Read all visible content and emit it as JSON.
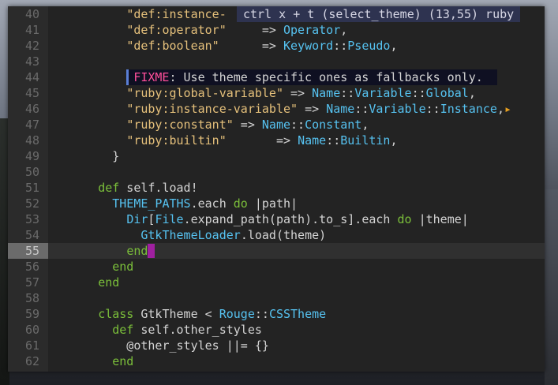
{
  "popup": {
    "text": "ctrl x + t (select_theme) (13,55) ruby"
  },
  "lines": [
    {
      "n": "40",
      "parts": [
        [
          "t",
          "          "
        ],
        [
          "s",
          "\"def:instance-"
        ]
      ]
    },
    {
      "n": "41",
      "parts": [
        [
          "t",
          "          "
        ],
        [
          "s",
          "\"def:operator\""
        ],
        [
          "t",
          "     => "
        ],
        [
          "c",
          "Operator"
        ],
        [
          "t",
          ","
        ]
      ]
    },
    {
      "n": "42",
      "parts": [
        [
          "t",
          "          "
        ],
        [
          "s",
          "\"def:boolean\""
        ],
        [
          "t",
          "      => "
        ],
        [
          "c",
          "Keyword"
        ],
        [
          "t",
          "::"
        ],
        [
          "c",
          "Pseudo"
        ],
        [
          "t",
          ","
        ]
      ]
    },
    {
      "n": "43",
      "parts": []
    },
    {
      "n": "44",
      "fixme": true,
      "label": "FIXME",
      "text": ": Use theme specific ones as fallbacks only."
    },
    {
      "n": "45",
      "parts": [
        [
          "t",
          "          "
        ],
        [
          "s",
          "\"ruby:global-variable\""
        ],
        [
          "t",
          " => "
        ],
        [
          "c",
          "Name"
        ],
        [
          "t",
          "::"
        ],
        [
          "c",
          "Variable"
        ],
        [
          "t",
          "::"
        ],
        [
          "c",
          "Global"
        ],
        [
          "t",
          ","
        ]
      ]
    },
    {
      "n": "46",
      "parts": [
        [
          "t",
          "          "
        ],
        [
          "s",
          "\"ruby:instance-variable\""
        ],
        [
          "t",
          " => "
        ],
        [
          "c",
          "Name"
        ],
        [
          "t",
          "::"
        ],
        [
          "c",
          "Variable"
        ],
        [
          "t",
          "::"
        ],
        [
          "c",
          "Instance"
        ],
        [
          "t",
          ","
        ]
      ],
      "overflow": "▸"
    },
    {
      "n": "47",
      "parts": [
        [
          "t",
          "          "
        ],
        [
          "s",
          "\"ruby:constant\""
        ],
        [
          "t",
          " => "
        ],
        [
          "c",
          "Name"
        ],
        [
          "t",
          "::"
        ],
        [
          "c",
          "Constant"
        ],
        [
          "t",
          ","
        ]
      ]
    },
    {
      "n": "48",
      "parts": [
        [
          "t",
          "          "
        ],
        [
          "s",
          "\"ruby:builtin\""
        ],
        [
          "t",
          "       => "
        ],
        [
          "c",
          "Name"
        ],
        [
          "t",
          "::"
        ],
        [
          "c",
          "Builtin"
        ],
        [
          "t",
          ","
        ]
      ]
    },
    {
      "n": "49",
      "parts": [
        [
          "t",
          "        }"
        ]
      ]
    },
    {
      "n": "50",
      "parts": []
    },
    {
      "n": "51",
      "parts": [
        [
          "t",
          "      "
        ],
        [
          "k",
          "def"
        ],
        [
          "t",
          " self.load!"
        ]
      ]
    },
    {
      "n": "52",
      "parts": [
        [
          "t",
          "        "
        ],
        [
          "c",
          "THEME_PATHS"
        ],
        [
          "t",
          ".each "
        ],
        [
          "k",
          "do"
        ],
        [
          "t",
          " |path|"
        ]
      ]
    },
    {
      "n": "53",
      "parts": [
        [
          "t",
          "          "
        ],
        [
          "c",
          "Dir"
        ],
        [
          "t",
          "["
        ],
        [
          "c",
          "File"
        ],
        [
          "t",
          ".expand_path(path).to_s].each "
        ],
        [
          "k",
          "do"
        ],
        [
          "t",
          " |theme|"
        ]
      ]
    },
    {
      "n": "54",
      "parts": [
        [
          "t",
          "            "
        ],
        [
          "c",
          "GtkThemeLoader"
        ],
        [
          "t",
          ".load(theme)"
        ]
      ]
    },
    {
      "n": "55",
      "current": true,
      "parts": [
        [
          "t",
          "          "
        ],
        [
          "k",
          "end"
        ]
      ]
    },
    {
      "n": "56",
      "parts": [
        [
          "t",
          "        "
        ],
        [
          "k",
          "end"
        ]
      ]
    },
    {
      "n": "57",
      "parts": [
        [
          "t",
          "      "
        ],
        [
          "k",
          "end"
        ]
      ]
    },
    {
      "n": "58",
      "parts": []
    },
    {
      "n": "59",
      "parts": [
        [
          "t",
          "      "
        ],
        [
          "k",
          "class"
        ],
        [
          "t",
          " GtkTheme < "
        ],
        [
          "c",
          "Rouge"
        ],
        [
          "t",
          "::"
        ],
        [
          "c",
          "CSSTheme"
        ]
      ]
    },
    {
      "n": "60",
      "parts": [
        [
          "t",
          "        "
        ],
        [
          "k",
          "def"
        ],
        [
          "t",
          " self.other_styles"
        ]
      ]
    },
    {
      "n": "61",
      "parts": [
        [
          "t",
          "          @other_styles ||= {}"
        ]
      ]
    },
    {
      "n": "62",
      "parts": [
        [
          "t",
          "        "
        ],
        [
          "k",
          "end"
        ]
      ]
    }
  ],
  "colors": {
    "string": "#e5c07b",
    "keyword": "#7bbf3a",
    "constant": "#56c2f0",
    "cursor": "#a020a0",
    "fixme": "#ff4f9a"
  }
}
